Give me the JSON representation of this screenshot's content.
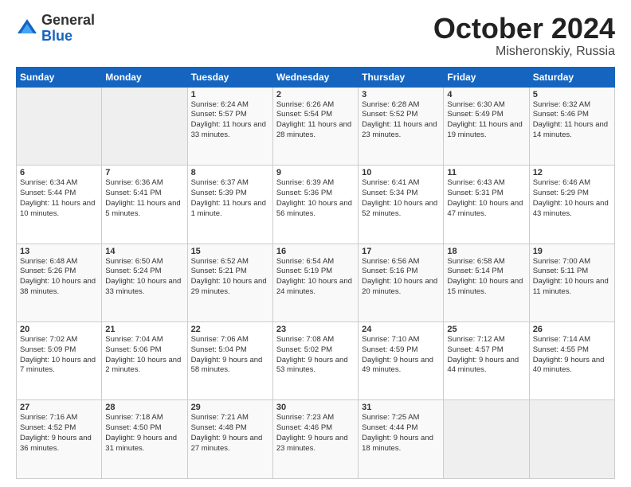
{
  "header": {
    "logo_general": "General",
    "logo_blue": "Blue",
    "month": "October 2024",
    "location": "Misheronskiy, Russia"
  },
  "days_of_week": [
    "Sunday",
    "Monday",
    "Tuesday",
    "Wednesday",
    "Thursday",
    "Friday",
    "Saturday"
  ],
  "weeks": [
    [
      {
        "day": "",
        "info": ""
      },
      {
        "day": "",
        "info": ""
      },
      {
        "day": "1",
        "info": "Sunrise: 6:24 AM\nSunset: 5:57 PM\nDaylight: 11 hours and 33 minutes."
      },
      {
        "day": "2",
        "info": "Sunrise: 6:26 AM\nSunset: 5:54 PM\nDaylight: 11 hours and 28 minutes."
      },
      {
        "day": "3",
        "info": "Sunrise: 6:28 AM\nSunset: 5:52 PM\nDaylight: 11 hours and 23 minutes."
      },
      {
        "day": "4",
        "info": "Sunrise: 6:30 AM\nSunset: 5:49 PM\nDaylight: 11 hours and 19 minutes."
      },
      {
        "day": "5",
        "info": "Sunrise: 6:32 AM\nSunset: 5:46 PM\nDaylight: 11 hours and 14 minutes."
      }
    ],
    [
      {
        "day": "6",
        "info": "Sunrise: 6:34 AM\nSunset: 5:44 PM\nDaylight: 11 hours and 10 minutes."
      },
      {
        "day": "7",
        "info": "Sunrise: 6:36 AM\nSunset: 5:41 PM\nDaylight: 11 hours and 5 minutes."
      },
      {
        "day": "8",
        "info": "Sunrise: 6:37 AM\nSunset: 5:39 PM\nDaylight: 11 hours and 1 minute."
      },
      {
        "day": "9",
        "info": "Sunrise: 6:39 AM\nSunset: 5:36 PM\nDaylight: 10 hours and 56 minutes."
      },
      {
        "day": "10",
        "info": "Sunrise: 6:41 AM\nSunset: 5:34 PM\nDaylight: 10 hours and 52 minutes."
      },
      {
        "day": "11",
        "info": "Sunrise: 6:43 AM\nSunset: 5:31 PM\nDaylight: 10 hours and 47 minutes."
      },
      {
        "day": "12",
        "info": "Sunrise: 6:46 AM\nSunset: 5:29 PM\nDaylight: 10 hours and 43 minutes."
      }
    ],
    [
      {
        "day": "13",
        "info": "Sunrise: 6:48 AM\nSunset: 5:26 PM\nDaylight: 10 hours and 38 minutes."
      },
      {
        "day": "14",
        "info": "Sunrise: 6:50 AM\nSunset: 5:24 PM\nDaylight: 10 hours and 33 minutes."
      },
      {
        "day": "15",
        "info": "Sunrise: 6:52 AM\nSunset: 5:21 PM\nDaylight: 10 hours and 29 minutes."
      },
      {
        "day": "16",
        "info": "Sunrise: 6:54 AM\nSunset: 5:19 PM\nDaylight: 10 hours and 24 minutes."
      },
      {
        "day": "17",
        "info": "Sunrise: 6:56 AM\nSunset: 5:16 PM\nDaylight: 10 hours and 20 minutes."
      },
      {
        "day": "18",
        "info": "Sunrise: 6:58 AM\nSunset: 5:14 PM\nDaylight: 10 hours and 15 minutes."
      },
      {
        "day": "19",
        "info": "Sunrise: 7:00 AM\nSunset: 5:11 PM\nDaylight: 10 hours and 11 minutes."
      }
    ],
    [
      {
        "day": "20",
        "info": "Sunrise: 7:02 AM\nSunset: 5:09 PM\nDaylight: 10 hours and 7 minutes."
      },
      {
        "day": "21",
        "info": "Sunrise: 7:04 AM\nSunset: 5:06 PM\nDaylight: 10 hours and 2 minutes."
      },
      {
        "day": "22",
        "info": "Sunrise: 7:06 AM\nSunset: 5:04 PM\nDaylight: 9 hours and 58 minutes."
      },
      {
        "day": "23",
        "info": "Sunrise: 7:08 AM\nSunset: 5:02 PM\nDaylight: 9 hours and 53 minutes."
      },
      {
        "day": "24",
        "info": "Sunrise: 7:10 AM\nSunset: 4:59 PM\nDaylight: 9 hours and 49 minutes."
      },
      {
        "day": "25",
        "info": "Sunrise: 7:12 AM\nSunset: 4:57 PM\nDaylight: 9 hours and 44 minutes."
      },
      {
        "day": "26",
        "info": "Sunrise: 7:14 AM\nSunset: 4:55 PM\nDaylight: 9 hours and 40 minutes."
      }
    ],
    [
      {
        "day": "27",
        "info": "Sunrise: 7:16 AM\nSunset: 4:52 PM\nDaylight: 9 hours and 36 minutes."
      },
      {
        "day": "28",
        "info": "Sunrise: 7:18 AM\nSunset: 4:50 PM\nDaylight: 9 hours and 31 minutes."
      },
      {
        "day": "29",
        "info": "Sunrise: 7:21 AM\nSunset: 4:48 PM\nDaylight: 9 hours and 27 minutes."
      },
      {
        "day": "30",
        "info": "Sunrise: 7:23 AM\nSunset: 4:46 PM\nDaylight: 9 hours and 23 minutes."
      },
      {
        "day": "31",
        "info": "Sunrise: 7:25 AM\nSunset: 4:44 PM\nDaylight: 9 hours and 18 minutes."
      },
      {
        "day": "",
        "info": ""
      },
      {
        "day": "",
        "info": ""
      }
    ]
  ]
}
